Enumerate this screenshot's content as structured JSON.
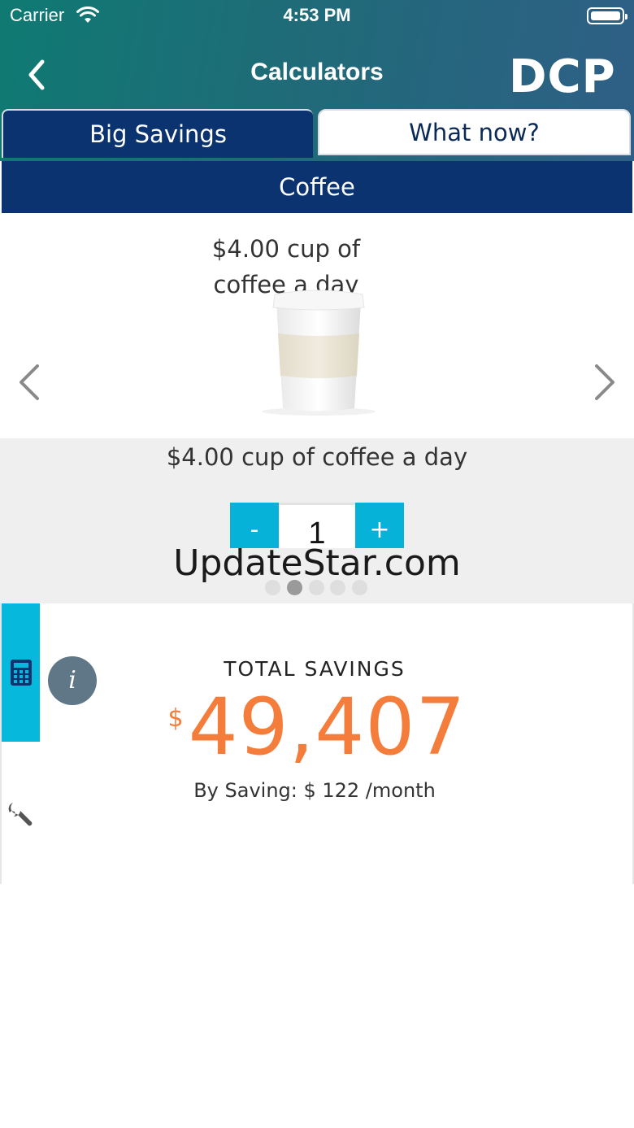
{
  "status_bar": {
    "carrier": "Carrier",
    "time": "4:53 PM"
  },
  "nav": {
    "title": "Calculators",
    "logo": "DCP"
  },
  "tabs": [
    {
      "label": "Big Savings",
      "active": true
    },
    {
      "label": "What now?",
      "active": false
    }
  ],
  "category": "Coffee",
  "carousel": {
    "caption": "$4.00 cup of coffee a day",
    "item_label": "$4.00 cup of coffee a day",
    "page_count": 5,
    "active_page": 2
  },
  "stepper": {
    "minus": "-",
    "value": "1",
    "plus": "+"
  },
  "watermark": "UpdateStar.com",
  "savings": {
    "label": "TOTAL SAVINGS",
    "currency": "$",
    "amount": "49,407",
    "by_saving": "By Saving: $ 122 /month"
  },
  "info_button": "i",
  "colors": {
    "navy": "#0a3370",
    "cyan": "#06b2d8",
    "orange": "#f47d3c",
    "header_teal": "#0f7a72"
  }
}
